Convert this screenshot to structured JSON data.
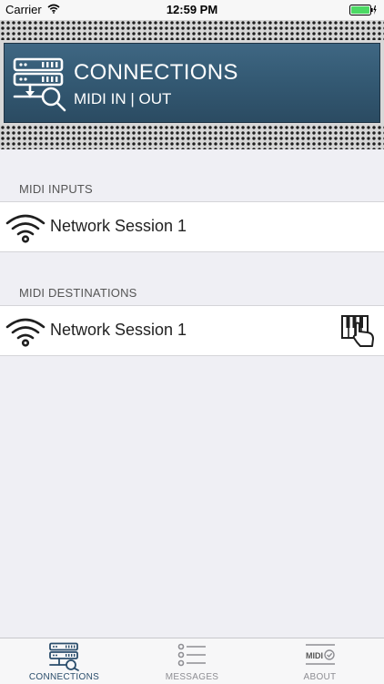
{
  "status_bar": {
    "carrier": "Carrier",
    "time": "12:59 PM"
  },
  "header": {
    "title": "CONNECTIONS",
    "subtitle": "MIDI IN | OUT"
  },
  "inputs": {
    "section_label": "MIDI INPUTS",
    "items": [
      {
        "name": "Network Session 1"
      }
    ]
  },
  "destinations": {
    "section_label": "MIDI DESTINATIONS",
    "items": [
      {
        "name": "Network Session 1"
      }
    ]
  },
  "tabs": [
    {
      "label": "CONNECTIONS",
      "icon": "connections-icon",
      "active": true
    },
    {
      "label": "MESSAGES",
      "icon": "messages-icon",
      "active": false
    },
    {
      "label": "ABOUT",
      "icon": "midi-about-icon",
      "active": false
    }
  ],
  "tab_midi_badge": "MIDI",
  "colors": {
    "accent": "#2b4e6c",
    "inactive": "#8e8e93",
    "panel": "#345a74",
    "background": "#efeff4"
  }
}
